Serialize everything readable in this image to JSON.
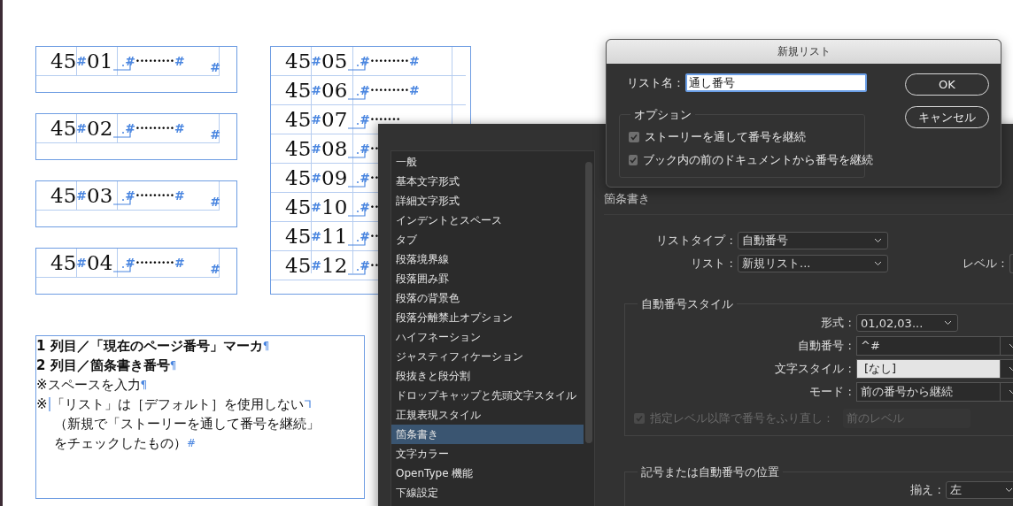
{
  "document": {
    "left_frames": [
      {
        "prefix": "45",
        "marker": "#",
        "suffix": "01",
        "tab_mark": "#",
        "leader": "·········",
        "leader_end": "#",
        "end_mark": "#"
      },
      {
        "prefix": "45",
        "marker": "#",
        "suffix": "02",
        "tab_mark": "#",
        "leader": "·········",
        "leader_end": "#",
        "end_mark": "#"
      },
      {
        "prefix": "45",
        "marker": "#",
        "suffix": "03",
        "tab_mark": "#",
        "leader": "·········",
        "leader_end": "#",
        "end_mark": "#"
      },
      {
        "prefix": "45",
        "marker": "#",
        "suffix": "04",
        "tab_mark": "#",
        "leader": "·········",
        "leader_end": "#",
        "end_mark": "#"
      }
    ],
    "right_frame": [
      {
        "prefix": "45",
        "marker": "#",
        "suffix": "05",
        "tab_mark": "#",
        "leader": "·········",
        "leader_end": "#"
      },
      {
        "prefix": "45",
        "marker": "#",
        "suffix": "06",
        "tab_mark": "#",
        "leader": "·········",
        "leader_end": "#"
      },
      {
        "prefix": "45",
        "marker": "#",
        "suffix": "07",
        "tab_mark": "#",
        "leader": "·······"
      },
      {
        "prefix": "45",
        "marker": "#",
        "suffix": "08",
        "tab_mark": "#",
        "leader": "··"
      },
      {
        "prefix": "45",
        "marker": "#",
        "suffix": "09",
        "tab_mark": "#",
        "leader": "··"
      },
      {
        "prefix": "45",
        "marker": "#",
        "suffix": "10",
        "tab_mark": "#",
        "leader": "··"
      },
      {
        "prefix": "45",
        "marker": "#",
        "suffix": "11",
        "tab_mark": "#",
        "leader": "··"
      },
      {
        "prefix": "45",
        "marker": "#",
        "suffix": "12",
        "tab_mark": "#",
        "leader": "··"
      }
    ],
    "notes": [
      {
        "text": "1 列目／「現在のページ番号」マーカ",
        "bold": true,
        "indented": false,
        "end": "¶"
      },
      {
        "text": "2 列目／箇条書き番号",
        "bold": true,
        "indented": false,
        "end": "¶"
      },
      {
        "text": "※スペースを入力",
        "bold": false,
        "indented": false,
        "end": "¶"
      },
      {
        "lead": "※",
        "text": "「リスト」は［デフォルト］を使用しない",
        "bold": false,
        "indented": false,
        "indent_here": true,
        "forced_break": true
      },
      {
        "text": "（新規で「ストーリーを通して番号を継続」",
        "bold": false,
        "indented": true
      },
      {
        "text": "をチェックしたもの）",
        "bold": false,
        "indented": true,
        "end": "#"
      }
    ]
  },
  "style_dialog": {
    "categories": [
      {
        "label": "一般",
        "selected": false
      },
      {
        "label": "基本文字形式",
        "selected": false
      },
      {
        "label": "詳細文字形式",
        "selected": false
      },
      {
        "label": "インデントとスペース",
        "selected": false
      },
      {
        "label": "タブ",
        "selected": false
      },
      {
        "label": "段落境界線",
        "selected": false
      },
      {
        "label": "段落囲み罫",
        "selected": false
      },
      {
        "label": "段落の背景色",
        "selected": false
      },
      {
        "label": "段落分離禁止オプション",
        "selected": false
      },
      {
        "label": "ハイフネーション",
        "selected": false
      },
      {
        "label": "ジャスティフィケーション",
        "selected": false
      },
      {
        "label": "段抜きと段分割",
        "selected": false
      },
      {
        "label": "ドロップキャップと先頭文字スタイル",
        "selected": false
      },
      {
        "label": "正規表現スタイル",
        "selected": false
      },
      {
        "label": "箇条書き",
        "selected": true
      },
      {
        "label": "文字カラー",
        "selected": false
      },
      {
        "label": "OpenType 機能",
        "selected": false
      },
      {
        "label": "下線設定",
        "selected": false
      }
    ],
    "section_title": "箇条書き",
    "list_type": {
      "label": "リストタイプ :",
      "value": "自動番号"
    },
    "list": {
      "label": "リスト :",
      "value": "新規リスト..."
    },
    "level": {
      "label": "レベル :"
    },
    "numbering_style": {
      "title": "自動番号スタイル",
      "fields": [
        {
          "kind": "select",
          "label": "形式 :",
          "value": "01,02,03..."
        },
        {
          "kind": "combo",
          "label": "自動番号 :",
          "value": "^#"
        },
        {
          "kind": "combo_light",
          "label": "文字スタイル :",
          "value": "[なし]"
        },
        {
          "kind": "combo",
          "label": "モード :",
          "value": "前の番号から継続"
        }
      ],
      "restart": {
        "label": "指定レベル以降で番号をふり直し :",
        "checked": true,
        "disabled": true,
        "value": "前のレベル"
      }
    },
    "position": {
      "title": "記号または自動番号の位置",
      "align": {
        "label": "揃え :",
        "value": "左"
      }
    }
  },
  "new_list_dialog": {
    "title": "新規リスト",
    "name_label": "リスト名 :",
    "name_value": "通し番号",
    "options_title": "オプション",
    "options": [
      {
        "label": "ストーリーを通して番号を継続",
        "checked": true
      },
      {
        "label": "ブック内の前のドキュメントから番号を継続",
        "checked": true
      }
    ],
    "buttons": [
      "OK",
      "キャンセル"
    ]
  }
}
